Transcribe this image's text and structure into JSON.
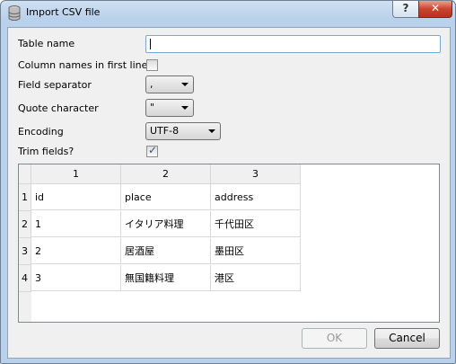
{
  "window": {
    "title": "Import CSV file",
    "help_glyph": "?",
    "close_glyph": "✕"
  },
  "form": {
    "table_name_label": "Table name",
    "table_name_value": "",
    "column_names_label": "Column names in first line",
    "column_names_checked": false,
    "field_separator_label": "Field separator",
    "field_separator_value": ",",
    "quote_character_label": "Quote character",
    "quote_character_value": "\"",
    "encoding_label": "Encoding",
    "encoding_value": "UTF-8",
    "trim_fields_label": "Trim fields?",
    "trim_fields_checked": true,
    "check_glyph": "✓"
  },
  "preview": {
    "column_headers": [
      "1",
      "2",
      "3"
    ],
    "row_headers": [
      "1",
      "2",
      "3",
      "4"
    ],
    "rows": [
      [
        "id",
        "place",
        "address"
      ],
      [
        "1",
        "イタリア料理",
        "千代田区"
      ],
      [
        "2",
        "居酒屋",
        "墨田区"
      ],
      [
        "3",
        "無国籍料理",
        "港区"
      ]
    ]
  },
  "buttons": {
    "ok_label": "OK",
    "cancel_label": "Cancel"
  }
}
